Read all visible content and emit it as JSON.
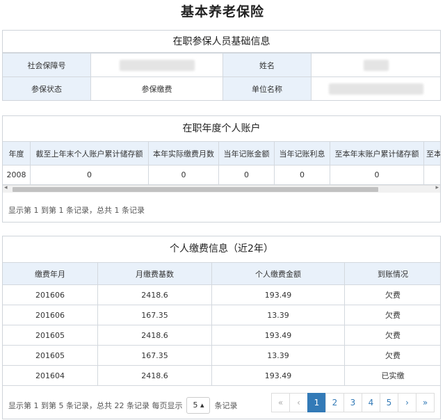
{
  "page_title": "基本养老保险",
  "basic_info": {
    "title": "在职参保人员基础信息",
    "rows": [
      {
        "label1": "社会保障号",
        "value1": "",
        "label2": "姓名",
        "value2": ""
      },
      {
        "label1": "参保状态",
        "value1": "参保缴费",
        "label2": "单位名称",
        "value2": ""
      }
    ]
  },
  "annual_account": {
    "title": "在职年度个人账户",
    "columns": [
      "年度",
      "截至上年末个人账户累计储存额",
      "本年实际缴费月数",
      "当年记账金额",
      "当年记账利息",
      "至本年末账户累计储存额",
      "至本"
    ],
    "rows": [
      [
        "2008",
        "0",
        "0",
        "0",
        "0",
        "0",
        ""
      ]
    ],
    "scroll_left_arrow": "◂",
    "scroll_right_arrow": "▸",
    "info": "显示第 1 到第 1 条记录，总共 1 条记录"
  },
  "payment_info": {
    "title": "个人缴费信息（近2年）",
    "columns": [
      "缴费年月",
      "月缴费基数",
      "个人缴费金额",
      "到账情况"
    ],
    "rows": [
      [
        "201606",
        "2418.6",
        "193.49",
        "欠费"
      ],
      [
        "201606",
        "167.35",
        "13.39",
        "欠费"
      ],
      [
        "201605",
        "2418.6",
        "193.49",
        "欠费"
      ],
      [
        "201605",
        "167.35",
        "13.39",
        "欠费"
      ],
      [
        "201604",
        "2418.6",
        "193.49",
        "已实缴"
      ]
    ],
    "info_prefix": "显示第 1 到第 5 条记录，总共 22 条记录 每页显示",
    "page_size": "5 ▴",
    "info_suffix": "条记录",
    "pager": {
      "first": "«",
      "prev": "‹",
      "pages": [
        "1",
        "2",
        "3",
        "4",
        "5"
      ],
      "current": "1",
      "next": "›",
      "last": "»"
    }
  }
}
